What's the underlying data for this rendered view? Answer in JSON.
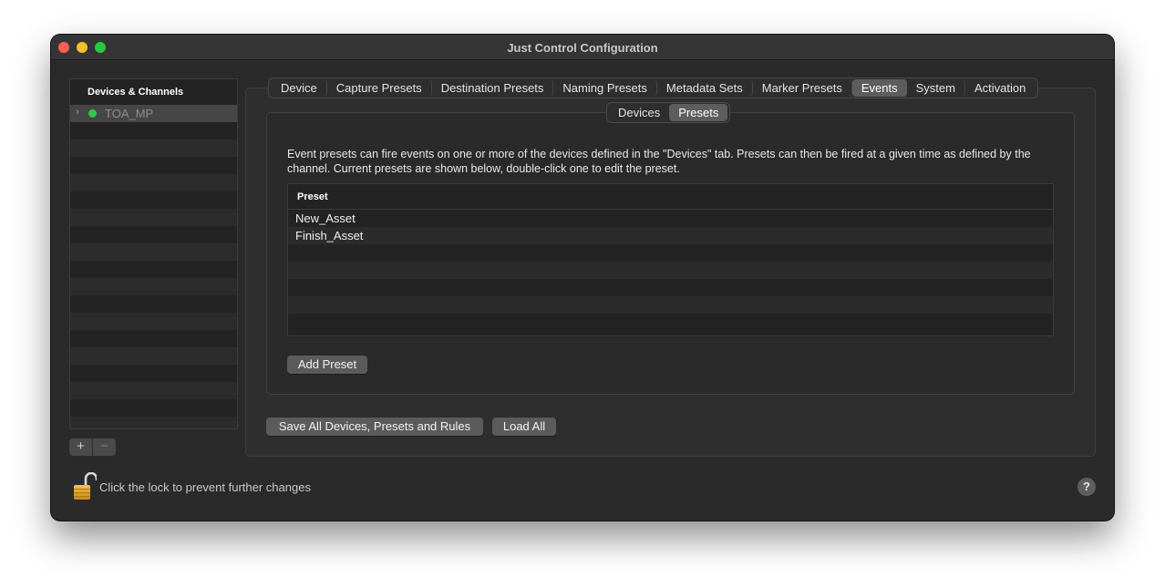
{
  "window": {
    "title": "Just Control Configuration"
  },
  "sidebar": {
    "header": "Devices & Channels",
    "items": [
      {
        "label": "TOA_MP",
        "status_color": "#33c748"
      }
    ],
    "add_label": "+",
    "remove_label": "−"
  },
  "tabs": [
    {
      "label": "Device"
    },
    {
      "label": "Capture Presets"
    },
    {
      "label": "Destination Presets"
    },
    {
      "label": "Naming Presets"
    },
    {
      "label": "Metadata Sets"
    },
    {
      "label": "Marker Presets"
    },
    {
      "label": "Events",
      "active": true
    },
    {
      "label": "System"
    },
    {
      "label": "Activation"
    }
  ],
  "subtabs": [
    {
      "label": "Devices"
    },
    {
      "label": "Presets",
      "active": true
    }
  ],
  "events": {
    "description": "Event presets can fire events on one or more of the devices defined in the \"Devices\" tab. Presets can then be fired at a given time as defined by the channel. Current presets are shown below, double-click one to edit the preset.",
    "table": {
      "column": "Preset",
      "rows": [
        "New_Asset",
        "Finish_Asset"
      ]
    },
    "add_button": "Add Preset"
  },
  "footer": {
    "save_all": "Save All Devices, Presets and Rules",
    "load_all": "Load All",
    "lock_text": "Click the lock to prevent further changes",
    "help": "?"
  },
  "icons": {
    "chevron": "chevron-right-icon",
    "lock": "unlocked-lock-icon",
    "help": "help-icon"
  }
}
